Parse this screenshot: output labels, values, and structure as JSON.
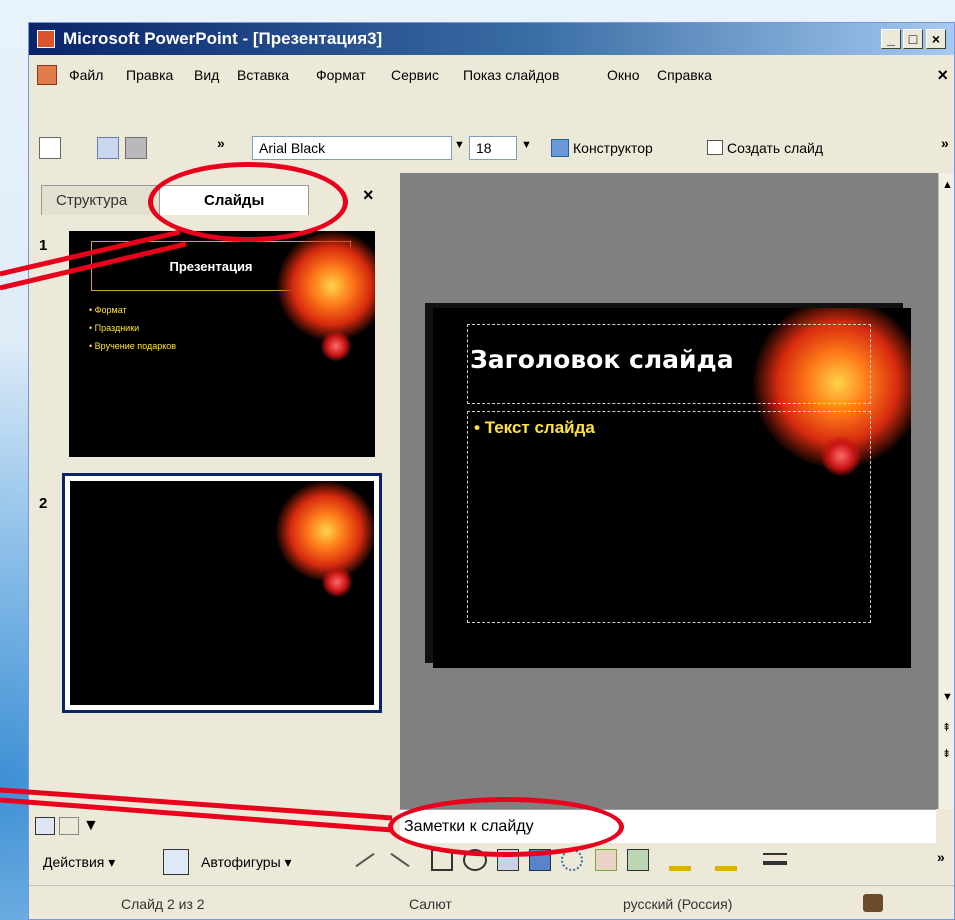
{
  "window": {
    "title": "Microsoft PowerPoint - [Презентация3]",
    "minimize": "_",
    "maximize": "□",
    "close": "×"
  },
  "menu": {
    "items": [
      "Файл",
      "Правка",
      "Вид",
      "Вставка",
      "Формат",
      "Сервис",
      "Показ слайдов",
      "Окно",
      "Справка"
    ],
    "close": "×"
  },
  "toolbar": {
    "overflow": "»",
    "font": "Arial Black",
    "size": "18",
    "designer": "Конструктор",
    "new_slide": "Создать слайд"
  },
  "left_pane": {
    "tabs": [
      "Структура",
      "Слайды"
    ],
    "active_tab": "Слайды",
    "close": "×",
    "slides": [
      {
        "number": "1",
        "title": "Презентация",
        "bullets": [
          "Формат",
          "Праздники",
          "Вручение подарков"
        ]
      },
      {
        "number": "2",
        "title": "",
        "bullets": []
      }
    ]
  },
  "main_slide": {
    "title": "Заголовок слайда",
    "body": "Текст слайда"
  },
  "notes": {
    "placeholder": "Заметки к слайду"
  },
  "drawing": {
    "actions": "Действия",
    "autoshapes": "Автофигуры",
    "dropdown": "▾"
  },
  "status": {
    "slide": "Слайд 2 из 2",
    "design": "Салют",
    "language": "русский (Россия)"
  },
  "colors": {
    "titlebar": "#0a246a",
    "slide_bg": "#000000",
    "slide_text": "#ffffff",
    "bullet_text": "#ffe23a",
    "annotation": "#e8001c"
  }
}
